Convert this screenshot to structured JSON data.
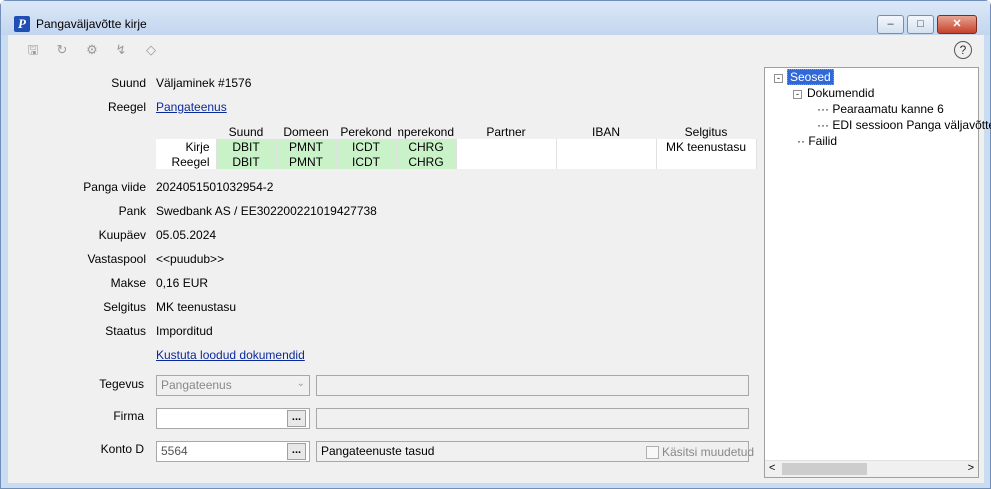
{
  "window": {
    "title": "Pangaväljavõtte kirje",
    "icon": "P"
  },
  "toolbar": {
    "icons": [
      "save-icon",
      "refresh-icon",
      "settings-icon",
      "lightning-icon",
      "tag-icon"
    ],
    "help": "?"
  },
  "form": {
    "suund_label": "Suund",
    "suund_value": "Väljaminek #1576",
    "reegel_label": "Reegel",
    "reegel_value": "Pangateenus",
    "table": {
      "headers": [
        "Suund",
        "Domeen",
        "Perekond",
        "Alamperekond",
        "Partner",
        "IBAN",
        "Selgitus"
      ],
      "rows": [
        {
          "label": "Kirje",
          "cells": [
            "DBIT",
            "PMNT",
            "ICDT",
            "CHRG",
            "",
            "",
            "MK teenustasu"
          ]
        },
        {
          "label": "Reegel",
          "cells": [
            "DBIT",
            "PMNT",
            "ICDT",
            "CHRG",
            "",
            "",
            ""
          ]
        }
      ]
    },
    "panga_viide_label": "Panga viide",
    "panga_viide_value": "2024051501032954-2",
    "pank_label": "Pank",
    "pank_value": "Swedbank AS / EE302200221019427738",
    "kuupaev_label": "Kuupäev",
    "kuupaev_value": "05.05.2024",
    "vastaspool_label": "Vastaspool",
    "vastaspool_value": "<<puudub>>",
    "makse_label": "Makse",
    "makse_value": "0,16 EUR",
    "selgitus_label": "Selgitus",
    "selgitus_value": "MK teenustasu",
    "staatus_label": "Staatus",
    "staatus_value": "Imporditud",
    "delete_link": "Kustuta loodud dokumendid",
    "tegevus_label": "Tegevus",
    "tegevus_value": "Pangateenus",
    "firma_label": "Firma",
    "firma_value": "",
    "konto_label": "Konto D",
    "konto_value": "5564",
    "konto_desc": "Pangateenuste tasud",
    "manual_label": "Käsitsi muudetud",
    "dots": "..."
  },
  "tree": {
    "root": "Seosed",
    "dokumendid": "Dokumendid",
    "doc1": "Pearaamatu kanne 6",
    "doc2": "EDI sessioon Panga väljavõtte",
    "failid": "Failid"
  }
}
